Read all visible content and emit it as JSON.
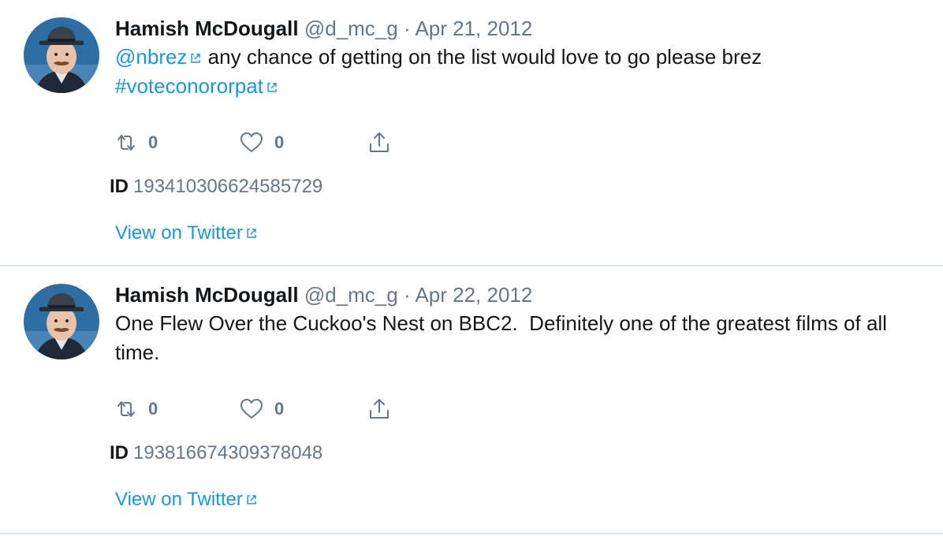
{
  "tweets": [
    {
      "name": "Hamish McDougall",
      "handle": "@d_mc_g",
      "separator": "·",
      "date": "Apr 21, 2012",
      "mention": "@nbrez",
      "text": "any chance of getting on the list would love to go please brez",
      "hashtag": "#voteconororpat",
      "retweets": "0",
      "likes": "0",
      "id_label": "ID",
      "id_value": "193410306624585729",
      "view_label": "View on Twitter"
    },
    {
      "name": "Hamish McDougall",
      "handle": "@d_mc_g",
      "separator": "·",
      "date": "Apr 22, 2012",
      "text": "One Flew Over the Cuckoo's Nest on BBC2.  Definitely one of the greatest films of all time.",
      "retweets": "0",
      "likes": "0",
      "id_label": "ID",
      "id_value": "193816674309378048",
      "view_label": "View on Twitter"
    }
  ],
  "icons": {
    "retweet": "retweet-icon",
    "like": "heart-icon",
    "share": "share-icon",
    "external": "external-link-icon"
  },
  "colors": {
    "link": "#1b95e0",
    "secondary": "#657786",
    "divider": "#e1e8ed"
  }
}
